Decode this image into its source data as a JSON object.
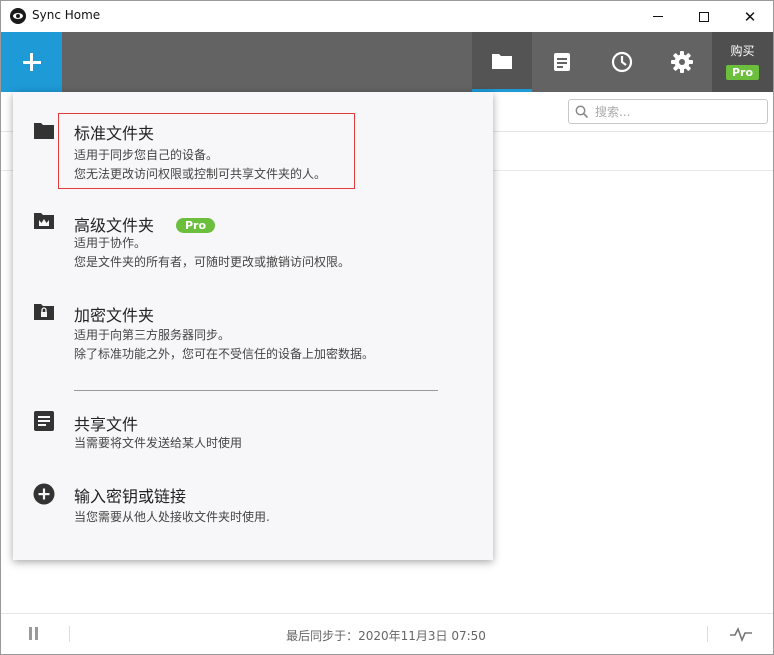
{
  "window": {
    "title": "Sync Home",
    "minimize_symbol": "—",
    "maximize_symbol": "☐",
    "close_symbol": "✕"
  },
  "toolbar": {
    "add_icon": "plus-icon",
    "tabs": [
      {
        "icon": "folder-icon",
        "active": true
      },
      {
        "icon": "history-icon",
        "active": false
      },
      {
        "icon": "clock-icon",
        "active": false
      },
      {
        "icon": "gear-icon",
        "active": false
      }
    ],
    "buy_label": "购买",
    "pro_label": "Pro"
  },
  "search": {
    "placeholder": "搜索..."
  },
  "menu": {
    "items": [
      {
        "icon": "folder-icon",
        "title": "标准文件夹",
        "desc1": "适用于同步您自己的设备。",
        "desc2": "您无法更改访问权限或控制可共享文件夹的人。"
      },
      {
        "icon": "crown-folder-icon",
        "title": "高级文件夹",
        "badge": "Pro",
        "desc1": "适用于协作。",
        "desc2": "您是文件夹的所有者，可随时更改或撤销访问权限。"
      },
      {
        "icon": "lock-folder-icon",
        "title": "加密文件夹",
        "desc1": "适用于向第三方服务器同步。",
        "desc2": "除了标准功能之外，您可在不受信任的设备上加密数据。"
      },
      {
        "icon": "document-icon",
        "title": "共享文件",
        "desc1": "当需要将文件发送给某人时使用"
      },
      {
        "icon": "plus-circle-icon",
        "title": "输入密钥或链接",
        "desc1": "当您需要从他人处接收文件夹时使用."
      }
    ]
  },
  "status": {
    "text": "最后同步于：2020年11月3日 07:50"
  },
  "colors": {
    "accent": "#1e9ad6",
    "toolbar": "#636363",
    "pro_green": "#6cbf3c",
    "highlight": "#e03a3a"
  }
}
